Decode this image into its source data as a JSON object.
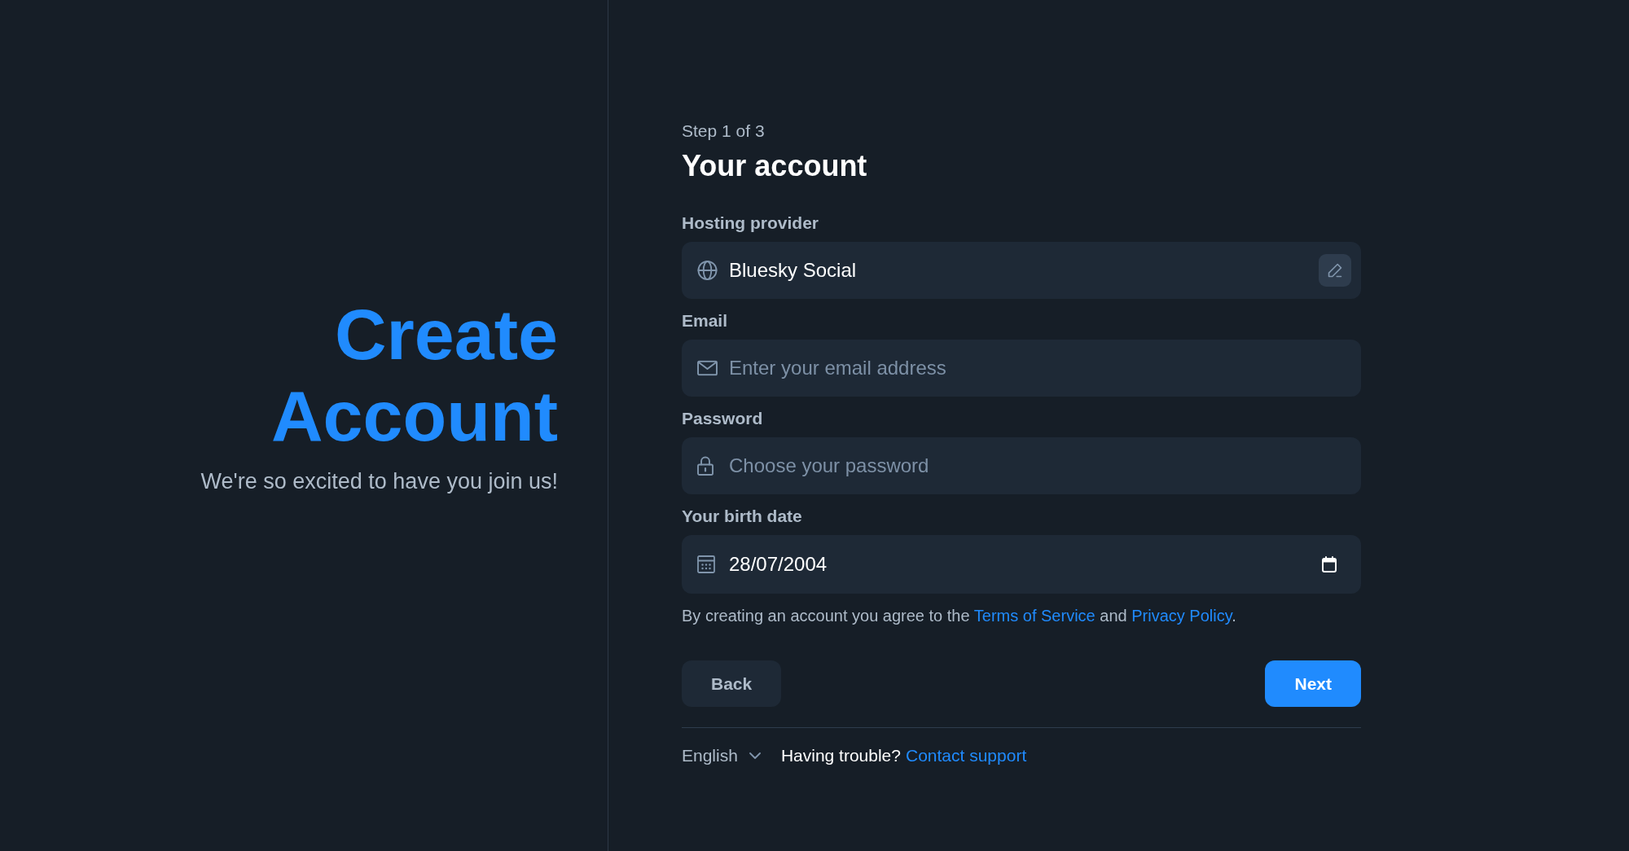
{
  "hero": {
    "title": "Create Account",
    "subtitle": "We're so excited to have you join us!"
  },
  "form": {
    "step": "Step 1 of 3",
    "title": "Your account",
    "fields": [
      {
        "kind": "provider",
        "label": "Hosting provider",
        "value": "Bluesky Social"
      },
      {
        "kind": "email",
        "label": "Email",
        "placeholder": "Enter your email address"
      },
      {
        "kind": "password",
        "label": "Password",
        "placeholder": "Choose your password"
      },
      {
        "kind": "date",
        "label": "Your birth date",
        "value": "28/07/2004"
      }
    ],
    "agreement": [
      {
        "kind": "text",
        "text": "By creating an account you agree to the "
      },
      {
        "kind": "link",
        "text": "Terms of Service"
      },
      {
        "kind": "text",
        "text": " and "
      },
      {
        "kind": "link",
        "text": "Privacy Policy"
      },
      {
        "kind": "text",
        "text": "."
      }
    ],
    "buttons": [
      {
        "kind": "back",
        "label": "Back"
      },
      {
        "kind": "next",
        "label": "Next"
      }
    ]
  },
  "footer": {
    "language": "English",
    "help_text": "Having trouble?",
    "help_link": "Contact support"
  }
}
